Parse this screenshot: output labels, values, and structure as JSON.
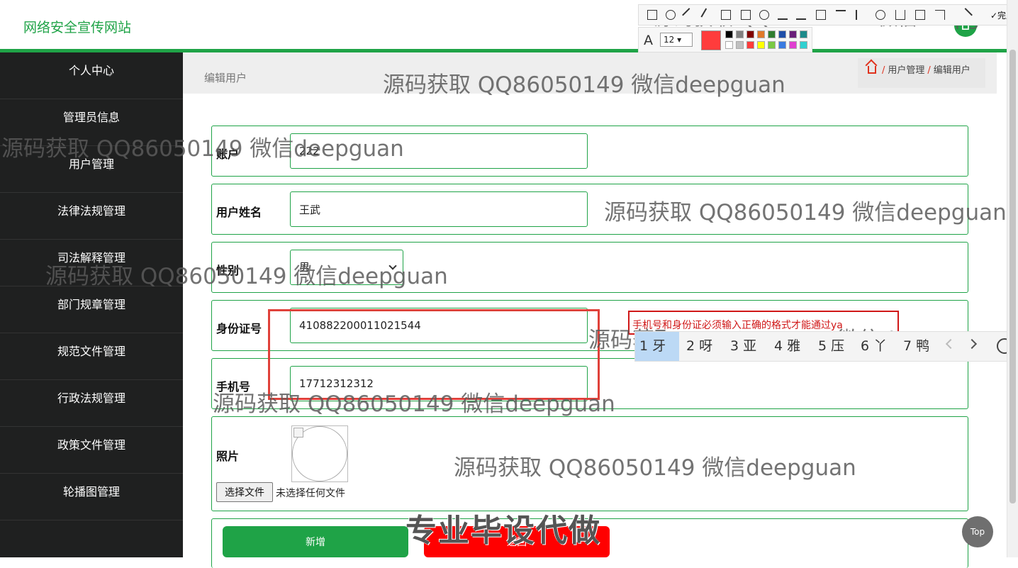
{
  "header": {
    "site_title": "网络安全宣传网站",
    "user_initial": "⌂"
  },
  "sidebar": {
    "items": [
      {
        "label": "个人中心"
      },
      {
        "label": "管理员信息"
      },
      {
        "label": "用户管理"
      },
      {
        "label": "法律法规管理"
      },
      {
        "label": "司法解释管理"
      },
      {
        "label": "部门规章管理"
      },
      {
        "label": "规范文件管理"
      },
      {
        "label": "行政法规管理"
      },
      {
        "label": "政策文件管理"
      },
      {
        "label": "轮播图管理"
      }
    ]
  },
  "page": {
    "title": "编辑用户",
    "breadcrumb": [
      "用户管理",
      "编辑用户"
    ]
  },
  "form": {
    "account": {
      "label": "账户",
      "value": "222"
    },
    "name": {
      "label": "用户姓名",
      "value": "王武"
    },
    "gender": {
      "label": "性别",
      "value": "男"
    },
    "id_card": {
      "label": "身份证号",
      "value": "410882200011021544"
    },
    "phone": {
      "label": "手机号",
      "value": "17712312312"
    },
    "photo": {
      "label": "照片",
      "choose_label": "选择文件",
      "status": "未选择任何文件"
    },
    "add_label": "新增",
    "back_label": "返回"
  },
  "annotation": {
    "tip": "手机号和身份证必须输入正确的格式才能通过ya",
    "watermark": "源码获取 QQ86050149 微信deepguan",
    "stamp": "专业毕设代做"
  },
  "ime": {
    "candidates": [
      "1 牙",
      "2 呀",
      "3 亚",
      "4 雅",
      "5 压",
      "6 丫",
      "7 鸭"
    ]
  },
  "snip_tool": {
    "font_size": "12",
    "done_label": "✓完成",
    "current_color": "#ff3c3c",
    "palette": [
      "#000000",
      "#808080",
      "#800000",
      "#e07a2a",
      "#2f7d2f",
      "#1f4fa8",
      "#6a1f7a",
      "#1d8a8a",
      "#ffffff",
      "#c0c0c0",
      "#ff3c3c",
      "#ffff00",
      "#7ac943",
      "#3a7be0",
      "#e040d0",
      "#30d0d0"
    ]
  },
  "top_button_label": "Top",
  "colors": {
    "accent": "#1fa347",
    "danger": "#ff0000",
    "sidebar": "#1f2020"
  }
}
